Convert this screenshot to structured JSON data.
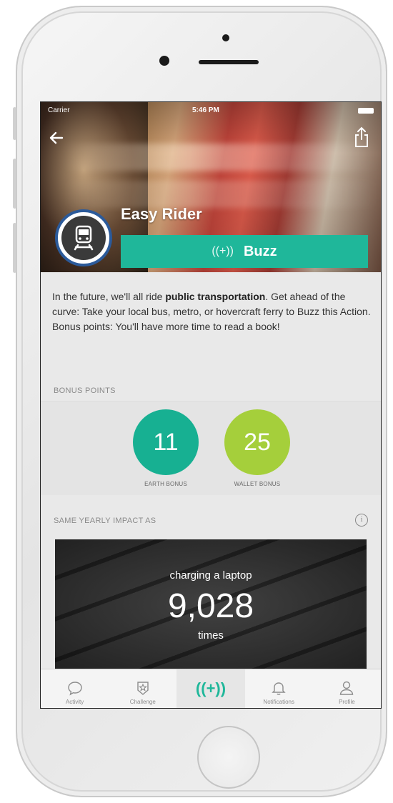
{
  "status": {
    "carrier": "Carrier",
    "time": "5:46 PM"
  },
  "action": {
    "title": "Easy Rider",
    "buzz_glyph": "((+))",
    "buzz_label": "Buzz",
    "desc_1": "In the future, we'll all ride ",
    "desc_bold": "public transportation",
    "desc_2": ". Get ahead of the curve: Take your local bus, metro, or hovercraft ferry to Buzz this Action. Bonus points: You'll have more time to read a book!"
  },
  "bonus": {
    "label": "BONUS POINTS",
    "earth": {
      "value": "11",
      "label": "EARTH BONUS"
    },
    "wallet": {
      "value": "25",
      "label": "WALLET BONUS"
    }
  },
  "impact": {
    "label": "SAME YEARLY IMPACT AS",
    "pre": "charging a laptop",
    "value": "9,028",
    "post": "times"
  },
  "tabs": [
    {
      "label": "Activity",
      "icon": "chat-bubble-icon"
    },
    {
      "label": "Challenge",
      "icon": "badge-icon"
    },
    {
      "label": "((+))",
      "icon": "buzz-icon"
    },
    {
      "label": "Notifications",
      "icon": "bell-icon"
    },
    {
      "label": "Profile",
      "icon": "person-icon"
    }
  ],
  "colors": {
    "accent": "#1fb79a",
    "earth": "#17b092",
    "wallet": "#a5cf3b",
    "badge_border": "#2b5a9a"
  }
}
